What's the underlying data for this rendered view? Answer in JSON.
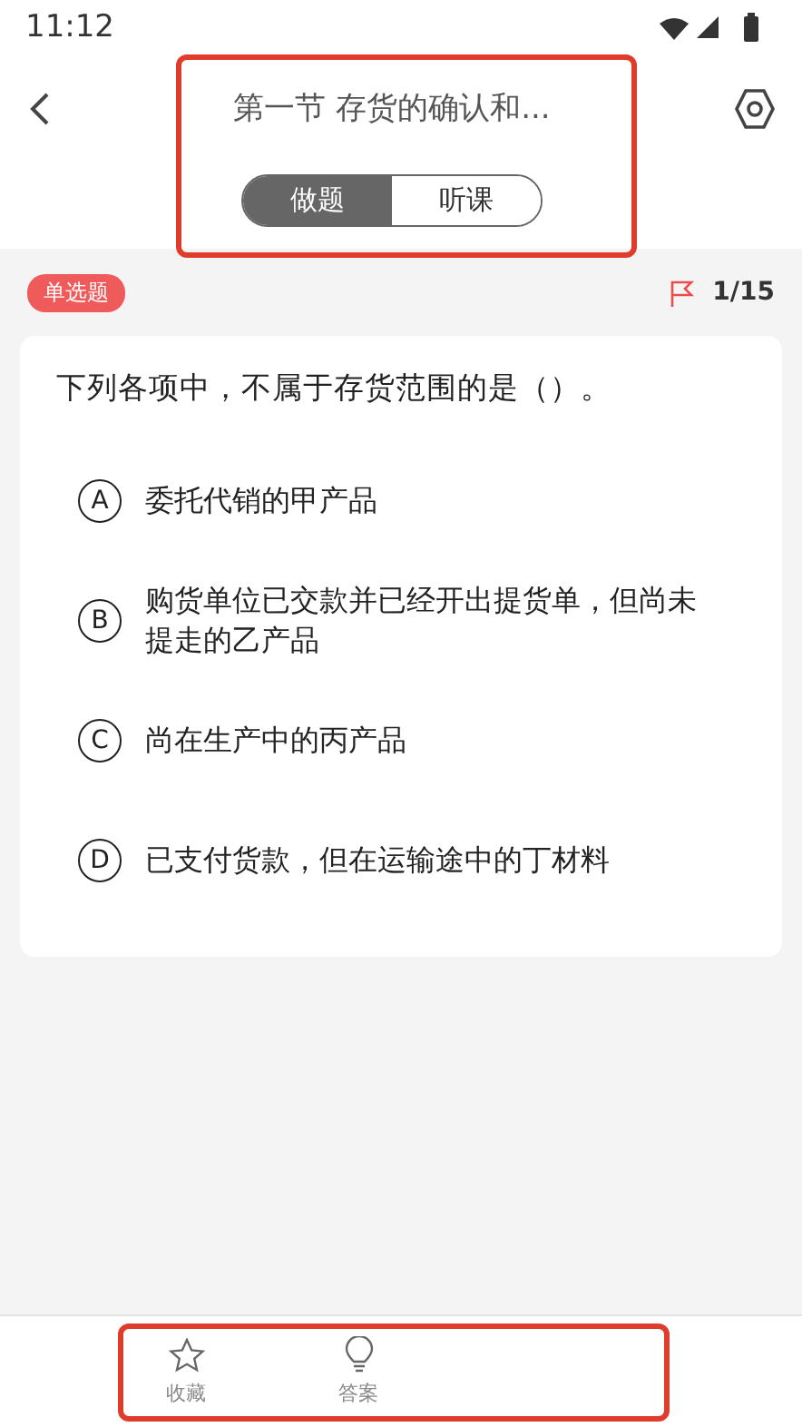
{
  "status_bar": {
    "time": "11:12"
  },
  "header": {
    "title": "第一节 存货的确认和...",
    "tabs": [
      {
        "label": "做题",
        "selected": true
      },
      {
        "label": "听课",
        "selected": false
      }
    ]
  },
  "question": {
    "type_badge": "单选题",
    "flagged": false,
    "progress": "1/15",
    "text": "下列各项中，不属于存货范围的是（）。",
    "options": [
      {
        "letter": "A",
        "text": "委托代销的甲产品",
        "selected": false
      },
      {
        "letter": "B",
        "text": "购货单位已交款并已经开出提货单，但尚未提走的乙产品",
        "selected": false
      },
      {
        "letter": "C",
        "text": "尚在生产中的丙产品",
        "selected": false
      },
      {
        "letter": "D",
        "text": "已支付货款，但在运输途中的丁材料",
        "selected": false
      }
    ]
  },
  "bottom_bar": [
    {
      "kind": "star",
      "label": "收藏"
    },
    {
      "kind": "bulb",
      "label": "答案"
    }
  ]
}
